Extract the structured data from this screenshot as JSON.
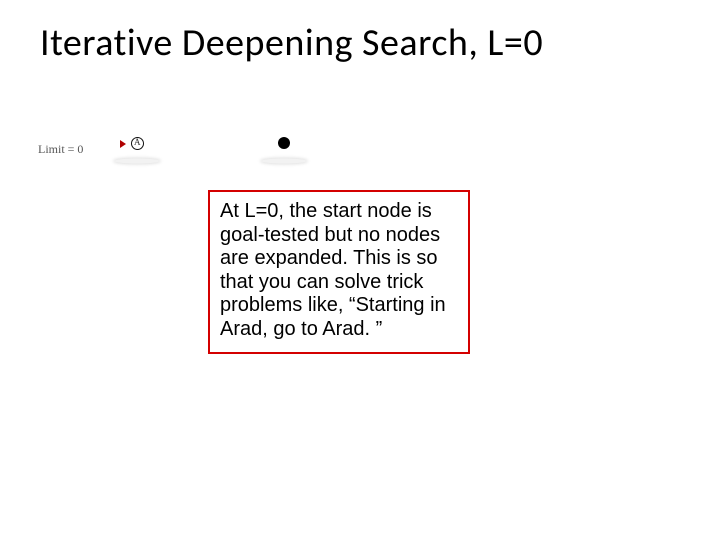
{
  "title": "Iterative Deepening Search,   L=0",
  "limit_label": "Limit = 0",
  "node_a_label": "A",
  "callout_text": "At L=0, the start node is goal-tested but no nodes are expanded.  This is so that you can solve trick problems like, “Starting in Arad, go to Arad. ”"
}
